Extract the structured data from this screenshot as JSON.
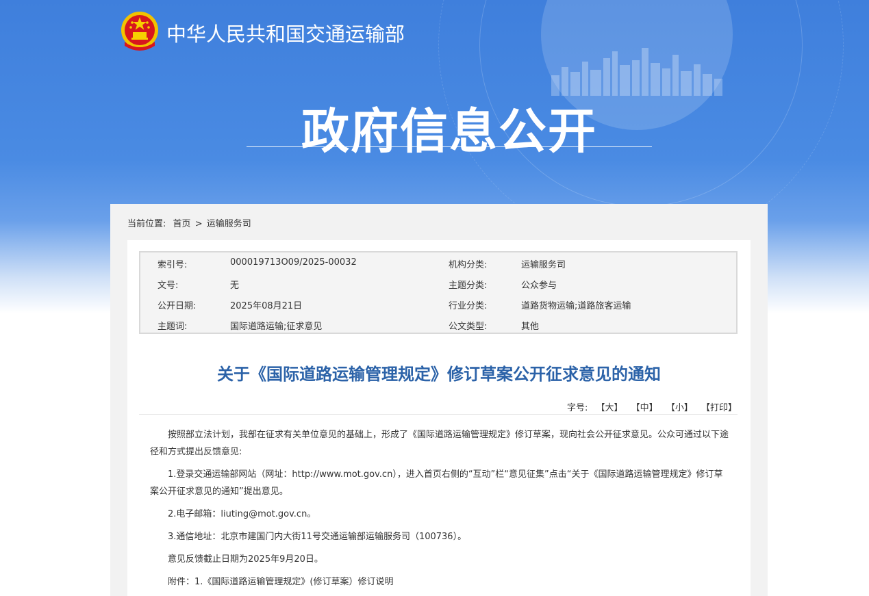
{
  "header": {
    "site_name": "中华人民共和国交通运输部",
    "hero_title": "政府信息公开"
  },
  "breadcrumb": {
    "label": "当前位置:",
    "home": "首页",
    "separator": ">",
    "current": "运输服务司"
  },
  "meta": {
    "index_label": "索引号:",
    "index_value": "000019713O09/2025-00032",
    "org_label": "机构分类:",
    "org_value": "运输服务司",
    "doc_no_label": "文号:",
    "doc_no_value": "无",
    "topic_label": "主题分类:",
    "topic_value": "公众参与",
    "date_label": "公开日期:",
    "date_value": "2025年08月21日",
    "industry_label": "行业分类:",
    "industry_value": "道路货物运输;道路旅客运输",
    "keywords_label": "主题词:",
    "keywords_value": "国际道路运输;征求意见",
    "type_label": "公文类型:",
    "type_value": "其他"
  },
  "article": {
    "title": "关于《国际道路运输管理规定》修订草案公开征求意见的通知",
    "paragraphs": [
      "按照部立法计划，我部在征求有关单位意见的基础上，形成了《国际道路运输管理规定》修订草案，现向社会公开征求意见。公众可通过以下途径和方式提出反馈意见:",
      "1.登录交通运输部网站（网址：http://www.mot.gov.cn），进入首页右侧的“互动”栏“意见征集”点击“关于《国际道路运输管理规定》修订草案公开征求意见的通知”提出意见。",
      "2.电子邮箱：liuting@mot.gov.cn。",
      "3.通信地址：北京市建国门内大街11号交通运输部运输服务司（100736）。",
      "意见反馈截止日期为2025年9月20日。",
      "附件：1.《国际道路运输管理规定》(修订草案）修订说明"
    ]
  },
  "font_tools": {
    "label": "字号:",
    "large": "【大】",
    "medium": "【中】",
    "small": "【小】",
    "print": "【打印】"
  },
  "colors": {
    "banner_blue": "#4a8be3",
    "title_blue": "#2b62a8"
  }
}
